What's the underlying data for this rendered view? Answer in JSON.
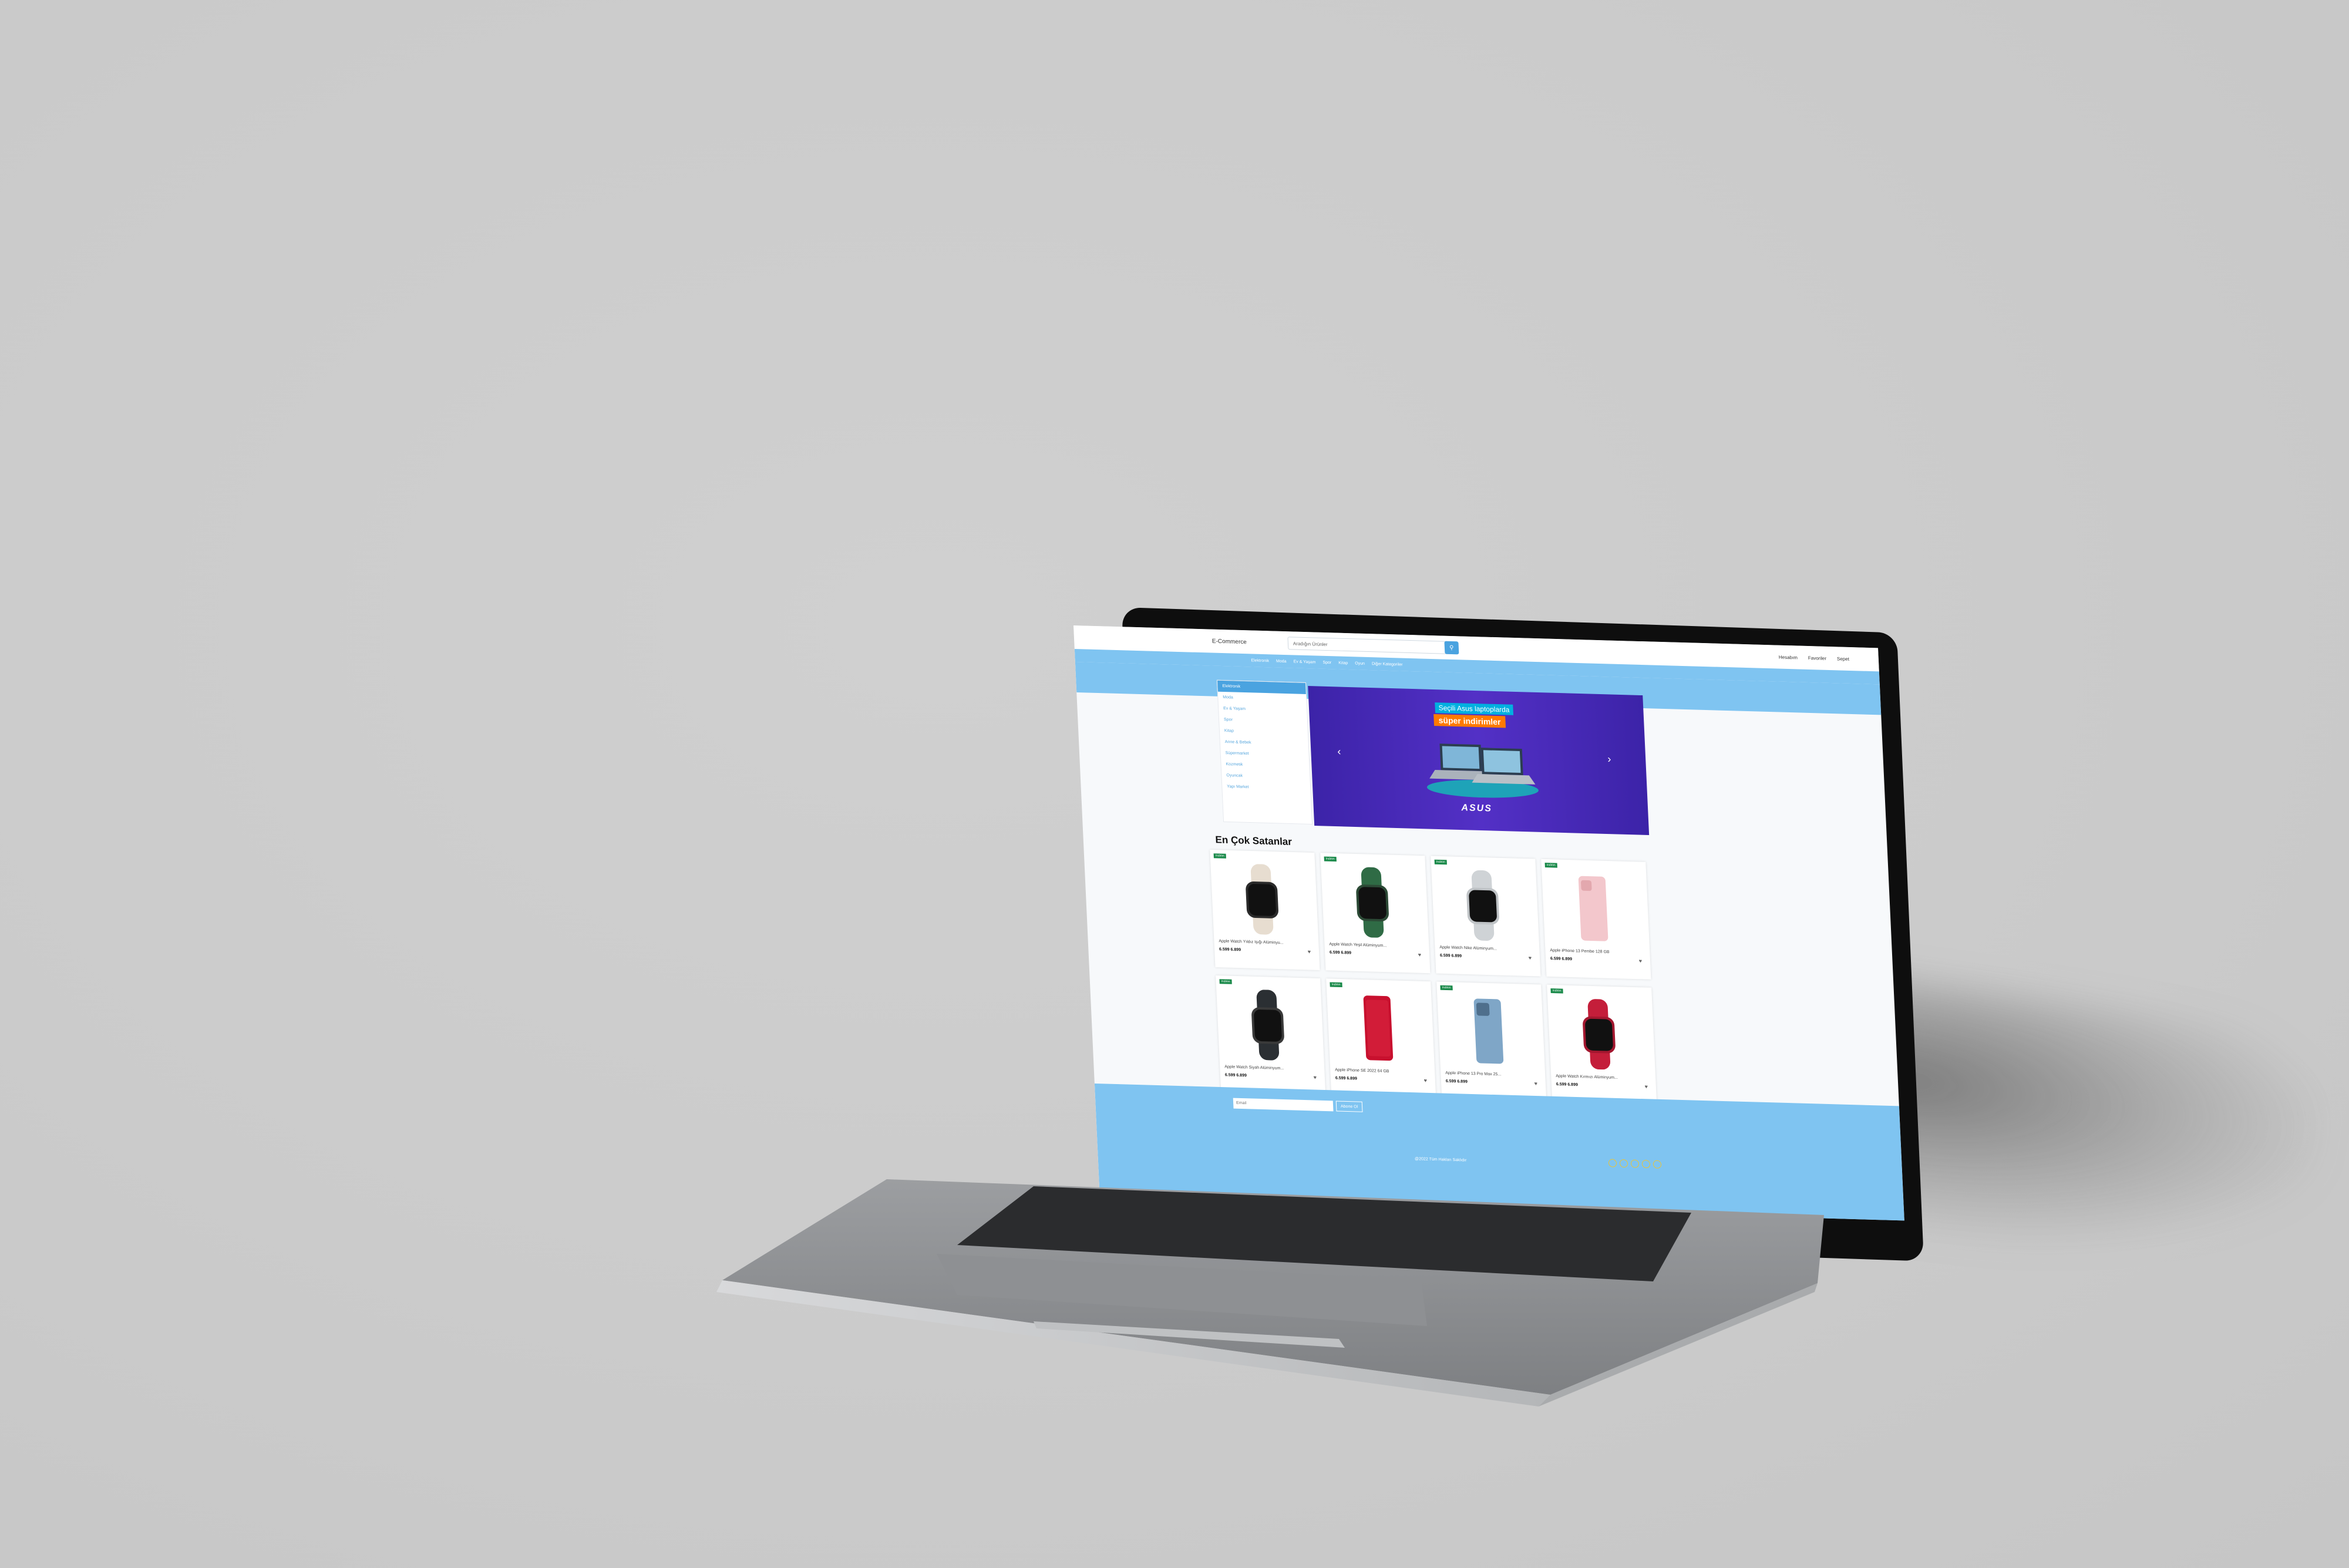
{
  "header": {
    "brand": "E-Commerce",
    "search_placeholder": "Aradığın Ürünler",
    "links": [
      "Hesabım",
      "Favoriler",
      "Sepet"
    ]
  },
  "navbar": {
    "items": [
      "Elektronik",
      "Moda",
      "Ev & Yaşam",
      "Spor",
      "Kitap",
      "Oyun",
      "Diğer Kategoriler"
    ]
  },
  "sidebar": {
    "items": [
      "Elektronik",
      "Moda",
      "Ev & Yaşam",
      "Spor",
      "Kitap",
      "Anne & Bebek",
      "Süpermarket",
      "Kozmetik",
      "Oyuncak",
      "Yapı Market"
    ]
  },
  "banner": {
    "line1": "Seçili Asus laptoplarda",
    "line2": "süper indirimler",
    "brand": "ASUS"
  },
  "section": {
    "title": "En Çok Satanlar"
  },
  "products": [
    {
      "badge": "Indirim",
      "name": "Apple Watch Yıldız Işığı Alüminyu...",
      "price": "6.599 6.899"
    },
    {
      "badge": "Indirim",
      "name": "Apple Watch Yeşil Alüminyum...",
      "price": "6.599 6.899"
    },
    {
      "badge": "Indirim",
      "name": "Apple Watch Nike Alüminyum...",
      "price": "6.599 6.899"
    },
    {
      "badge": "Indirim",
      "name": "Apple iPhone 13 Pembe 128 GB",
      "price": "6.599 6.899"
    },
    {
      "badge": "Indirim",
      "name": "Apple Watch Siyah Alüminyum...",
      "price": "6.599 6.899"
    },
    {
      "badge": "Indirim",
      "name": "Apple iPhone SE 2022 64 GB",
      "price": "6.599 6.899"
    },
    {
      "badge": "Indirim",
      "name": "Apple iPhone 13 Pro Max 25...",
      "price": "6.599 6.899"
    },
    {
      "badge": "Indirim",
      "name": "Apple Watch Kırmızı Alüminyum...",
      "price": "6.599 6.899"
    }
  ],
  "footer": {
    "email_placeholder": "Email",
    "subscribe": "Abone Ol",
    "copyright": "@2022 Tüm Hakları Saklıdır"
  },
  "colors": {
    "accent": "#7fc4f1",
    "badge": "#1a8a4a",
    "banner": "#4a2bb8",
    "background": "#cbcbcb"
  }
}
